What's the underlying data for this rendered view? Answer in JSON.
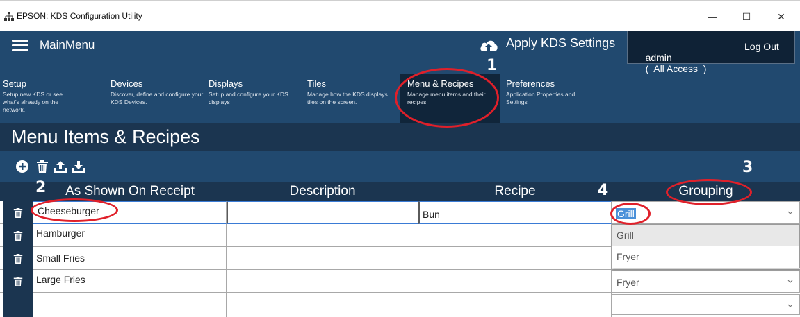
{
  "window": {
    "title": "EPSON: KDS Configuration Utility",
    "min_glyph": "—",
    "max_glyph": "☐",
    "close_glyph": "✕"
  },
  "header": {
    "main_menu_label": "MainMenu",
    "apply_label": "Apply KDS Settings",
    "user": {
      "name": "admin",
      "access_text": "(  All Access  )",
      "logout_label": "Log Out"
    },
    "nav": [
      {
        "title": "Setup",
        "desc": "Setup new KDS or see what's already on the network."
      },
      {
        "title": "Devices",
        "desc": "Discover, define and configure your KDS Devices."
      },
      {
        "title": "Displays",
        "desc": "Setup and configure your KDS displays"
      },
      {
        "title": "Tiles",
        "desc": "Manage how the KDS displays tiles on the screen."
      },
      {
        "title": "Menu & Recipes",
        "desc": "Manage menu items and their recipes"
      },
      {
        "title": "Preferences",
        "desc": "Application Properties and Settings"
      }
    ],
    "active_nav": "Menu & Recipes"
  },
  "page": {
    "title": "Menu Items & Recipes"
  },
  "table": {
    "columns": [
      "As Shown On Receipt",
      "Description",
      "Recipe",
      "Grouping"
    ],
    "rows": [
      {
        "name": "Cheeseburger",
        "description": "",
        "recipe": "Bun",
        "grouping": "Grill"
      },
      {
        "name": "Hamburger",
        "description": "",
        "recipe": "",
        "grouping": ""
      },
      {
        "name": "Small Fries",
        "description": "",
        "recipe": "",
        "grouping": ""
      },
      {
        "name": "Large Fries",
        "description": "",
        "recipe": "",
        "grouping": "Fryer"
      },
      {
        "name": "",
        "description": "",
        "recipe": "",
        "grouping": ""
      }
    ],
    "dropdown_options": [
      "Grill",
      "Fryer"
    ]
  },
  "annotations": [
    "1",
    "2",
    "3",
    "4"
  ],
  "colors": {
    "header_bg": "#21496f",
    "dark_band": "#1b3550",
    "annotation_red": "#e0202a",
    "selection_blue": "#4a90d9"
  }
}
